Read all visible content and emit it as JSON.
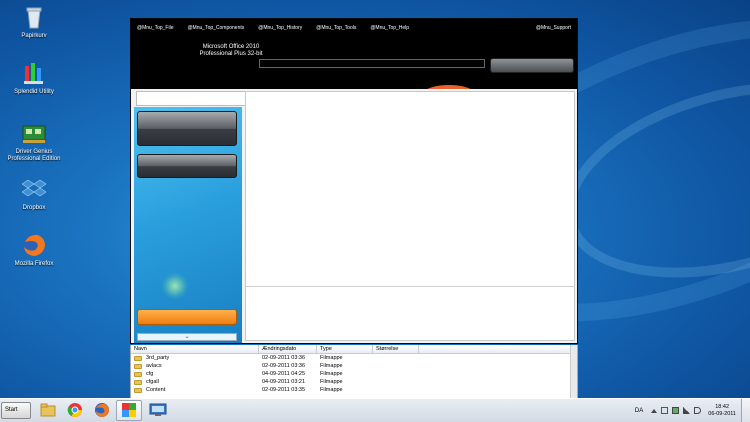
{
  "desktop": {
    "icons": [
      {
        "label": "Papirkurv",
        "icon": "recycle-bin-icon"
      },
      {
        "label": "Splendid Utility",
        "icon": "splendid-utility-icon"
      },
      {
        "label": "Driver Genius Professional Edition",
        "icon": "driver-genius-icon"
      },
      {
        "label": "Dropbox",
        "icon": "dropbox-icon"
      },
      {
        "label": "Mozilla Firefox",
        "icon": "firefox-icon"
      }
    ]
  },
  "app": {
    "menu": [
      "@Mnu_Top_File",
      "@Mnu_Top_Components",
      "@Mnu_Top_History",
      "@Mnu_Top_Tools",
      "@Mnu_Top_Help"
    ],
    "support": "@Mnu_Support",
    "title_line1": "Microsoft Office 2010",
    "title_line2": "Professional Plus 32-bit"
  },
  "explorer": {
    "headers": [
      "Navn",
      "Ændringsdato",
      "Type",
      "Størrelse"
    ],
    "rows": [
      {
        "name": "3rd_party",
        "date": "02-09-2011 03:36",
        "type": "Filmappe"
      },
      {
        "name": "avlacs",
        "date": "02-09-2011 03:36",
        "type": "Filmappe"
      },
      {
        "name": "cfg",
        "date": "04-09-2011 04:25",
        "type": "Filmappe"
      },
      {
        "name": "cfgall",
        "date": "04-09-2011 03:21",
        "type": "Filmappe"
      },
      {
        "name": "Content",
        "date": "02-09-2011 03:35",
        "type": "Filmappe"
      }
    ]
  },
  "taskbar": {
    "start_label": "Start",
    "apps": [
      "explorer-icon",
      "chrome-icon",
      "firefox-icon",
      "app-icon",
      "remote-desktop-icon"
    ],
    "language": "DA",
    "time": "18:42",
    "date": "06-09-2011"
  },
  "colors": {
    "desktop": "#1a73c0",
    "orange": "#f07e10",
    "pane": "#2a9fdd"
  }
}
